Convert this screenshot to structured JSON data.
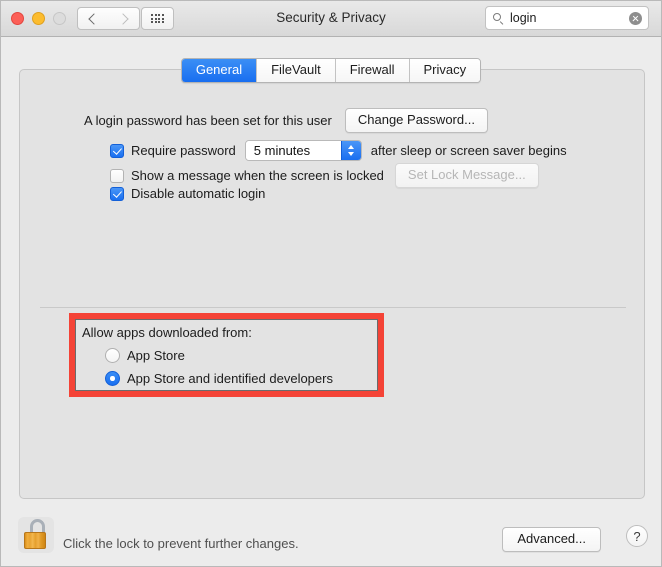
{
  "window": {
    "title": "Security & Privacy",
    "traffic_lights": {
      "close": "close-button",
      "minimize": "minimize-button",
      "zoom": "zoom-button"
    },
    "nav": {
      "back": "back-button",
      "forward": "forward-button",
      "show_all": "show-all-button"
    }
  },
  "search": {
    "value": "login",
    "placeholder": "Search",
    "clear": "clear-search-button"
  },
  "tabs": [
    {
      "label": "General",
      "selected": true
    },
    {
      "label": "FileVault",
      "selected": false
    },
    {
      "label": "Firewall",
      "selected": false
    },
    {
      "label": "Privacy",
      "selected": false
    }
  ],
  "general": {
    "password_status": "A login password has been set for this user",
    "change_password_label": "Change Password...",
    "require_password": {
      "label": "Require password",
      "checked": true,
      "interval": "5 minutes",
      "suffix": "after sleep or screen saver begins"
    },
    "show_message": {
      "label": "Show a message when the screen is locked",
      "checked": false,
      "button_label": "Set Lock Message...",
      "button_disabled": true
    },
    "disable_auto_login": {
      "label": "Disable automatic login",
      "checked": true
    },
    "gatekeeper": {
      "title": "Allow apps downloaded from:",
      "options": [
        {
          "label": "App Store",
          "selected": false
        },
        {
          "label": "App Store and identified developers",
          "selected": true
        }
      ],
      "highlight_color": "#f44336"
    }
  },
  "footer": {
    "lock_icon": "unlocked-padlock-icon",
    "lock_text": "Click the lock to prevent further changes.",
    "advanced_label": "Advanced...",
    "help_label": "?"
  }
}
